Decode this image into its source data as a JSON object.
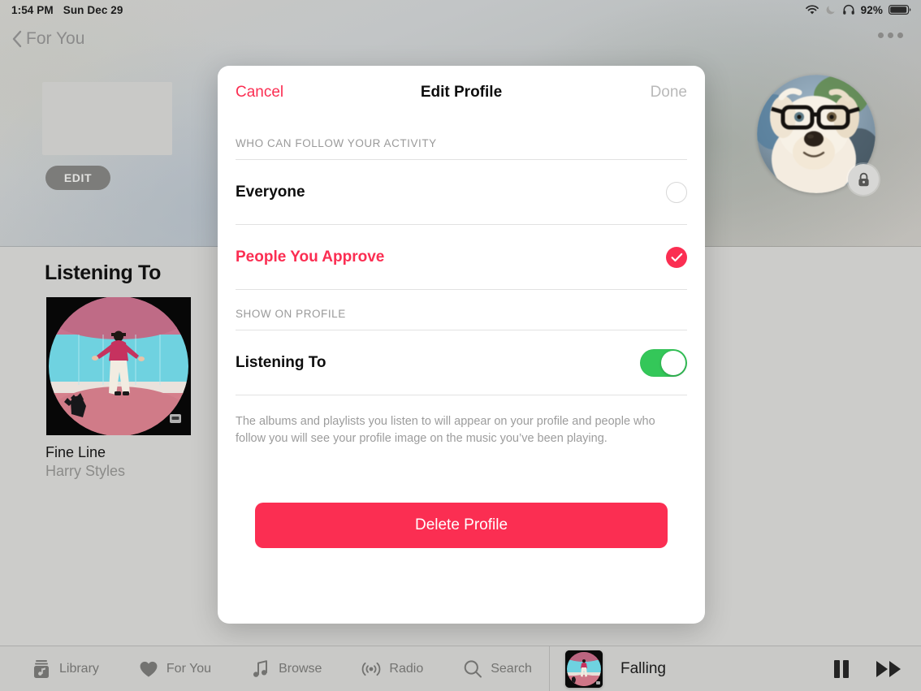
{
  "status_bar": {
    "time": "1:54 PM",
    "date": "Sun Dec 29",
    "battery_percent": "92%",
    "icons": [
      "wifi-icon",
      "moon-icon",
      "headphones-icon",
      "battery-icon"
    ]
  },
  "nav": {
    "back_label": "For You",
    "back_icon": "chevron-left-icon",
    "more_icon": "more-dots-icon"
  },
  "profile_header": {
    "edit_label": "EDIT",
    "avatar_name": "avatar",
    "lock_icon": "lock-icon"
  },
  "listening": {
    "section_title": "Listening To",
    "album": "Fine Line",
    "artist": "Harry Styles"
  },
  "modal": {
    "cancel_label": "Cancel",
    "title": "Edit Profile",
    "done_label": "Done",
    "section_follow_label": "WHO CAN FOLLOW YOUR ACTIVITY",
    "options": [
      {
        "label": "Everyone",
        "selected": false
      },
      {
        "label": "People You Approve",
        "selected": true
      }
    ],
    "section_show_label": "SHOW ON PROFILE",
    "toggle_row": {
      "label": "Listening To",
      "on": true
    },
    "footnote": "The albums and playlists you listen to will appear on your profile and people who follow you will see your profile image on the music you’ve been playing.",
    "delete_label": "Delete Profile",
    "accent_color": "#fb2e52",
    "toggle_on_color": "#34c759"
  },
  "tabbar": {
    "items": [
      {
        "label": "Library",
        "icon": "library-icon"
      },
      {
        "label": "For You",
        "icon": "heart-icon"
      },
      {
        "label": "Browse",
        "icon": "music-note-icon"
      },
      {
        "label": "Radio",
        "icon": "radio-broadcast-icon"
      },
      {
        "label": "Search",
        "icon": "search-icon"
      }
    ]
  },
  "now_playing": {
    "track": "Falling",
    "pause_icon": "pause-icon",
    "next_icon": "fast-forward-icon"
  }
}
